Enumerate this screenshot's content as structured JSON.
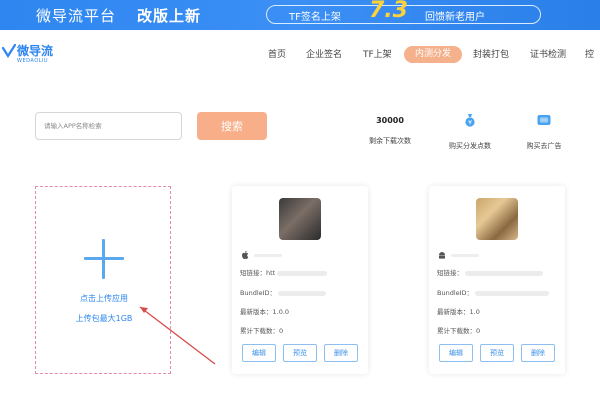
{
  "banner": {
    "title": "微导流平台",
    "subtitle": "改版上新",
    "pill_left": "TF签名上架",
    "big_number": "7.3",
    "pill_right": "回馈新老用户",
    "colors": {
      "bg": "#2f86f0",
      "highlight": "#ffd23a"
    }
  },
  "logo": {
    "name": "微导流",
    "sub": "WEDAOLIU"
  },
  "nav": {
    "items": [
      "首页",
      "企业签名",
      "TF上架",
      "内测分发",
      "封装打包",
      "证书检测",
      "控"
    ],
    "active_index": 3,
    "active_color": "#f5b08c"
  },
  "search": {
    "placeholder": "请输入APP名称检索",
    "button_label": "搜索",
    "button_color": "#f8ae88"
  },
  "stats": [
    {
      "value": "30000",
      "label": "剩余下载次数"
    },
    {
      "icon": "money-bag-icon",
      "label": "购买分发点数"
    },
    {
      "icon": "ad-icon",
      "label": "购买去广告"
    }
  ],
  "upload": {
    "line1": "点击上传应用",
    "line2": "上传包最大1GB"
  },
  "cards": [
    {
      "platform": "apple-icon",
      "short_link_label": "短链接：",
      "short_link_value": "htt",
      "bundle_label": "BundleID：",
      "version_label": "最新版本：",
      "version_value": "1.0.0",
      "downloads_label": "累计下载数：",
      "downloads_value": "0",
      "buttons": [
        "编辑",
        "预览",
        "删除"
      ]
    },
    {
      "platform": "android-icon",
      "short_link_label": "短链接：",
      "short_link_value": "",
      "bundle_label": "BundleID：",
      "version_label": "最新版本：",
      "version_value": "1.0",
      "downloads_label": "累计下载数：",
      "downloads_value": "0",
      "buttons": [
        "编辑",
        "预览",
        "删除"
      ]
    }
  ]
}
